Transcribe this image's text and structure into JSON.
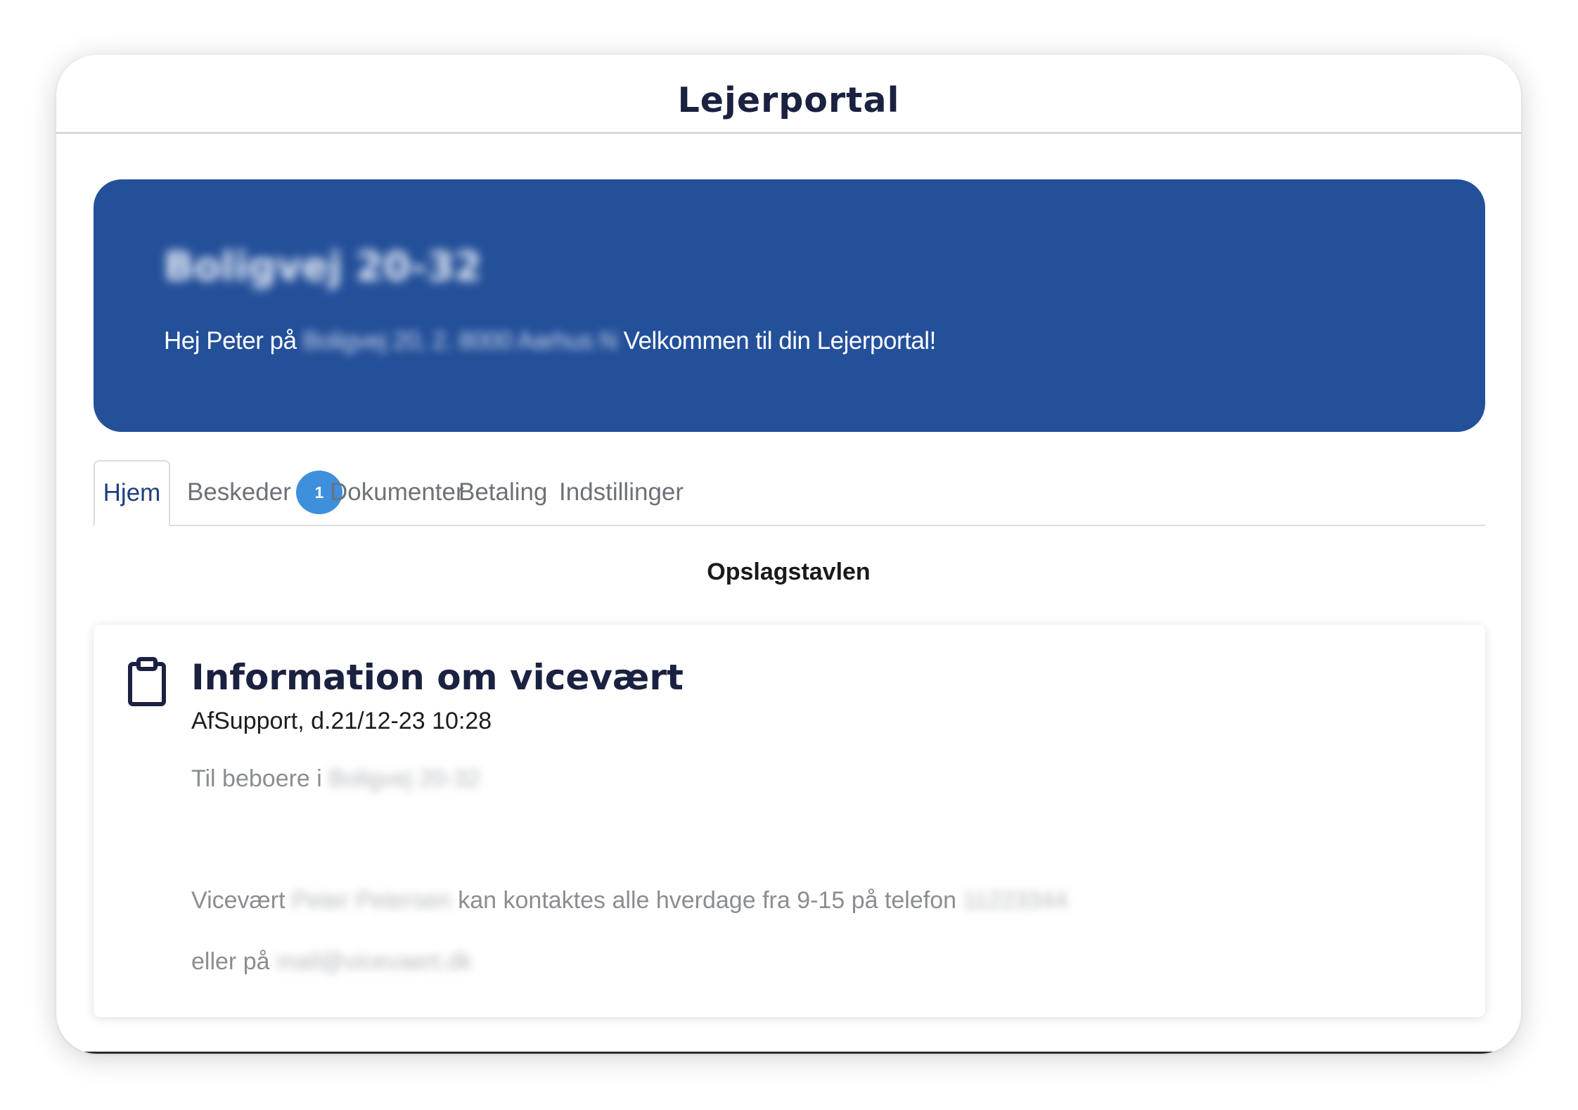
{
  "header": {
    "title": "Lejerportal"
  },
  "hero": {
    "property_name": "Boligvej 20-32",
    "greeting_prefix": "Hej Peter på",
    "address": "Boligvej 20, 2. 8000 Aarhus N",
    "greeting_suffix": "Velkommen til din Lejerportal!"
  },
  "tabs": [
    {
      "label": "Hjem",
      "active": true
    },
    {
      "label": "Beskeder",
      "badge": "1"
    },
    {
      "label": "Dokumenter"
    },
    {
      "label": "Betaling"
    },
    {
      "label": "Indstillinger"
    }
  ],
  "board": {
    "title": "Opslagstavlen"
  },
  "post": {
    "icon": "clipboard-icon",
    "title": "Information om vicevært",
    "meta": "AfSupport, d.21/12-23 10:28",
    "line1_prefix": "Til beboere i",
    "line1_blur": "Boligvej 20-32",
    "line2_prefix": "Vicevært",
    "line2_blur_name": "Peter Petersen",
    "line2_middle": "kan kontaktes alle hverdage fra 9-15 på telefon",
    "line2_blur_phone": "11223344",
    "line3_prefix": "eller på",
    "line3_blur_email": "mail@vicevaert.dk"
  },
  "colors": {
    "hero_bg": "#24509a",
    "title_text": "#1b2140",
    "badge_bg": "#3e8fdc",
    "active_tab_text": "#1e3f80"
  }
}
